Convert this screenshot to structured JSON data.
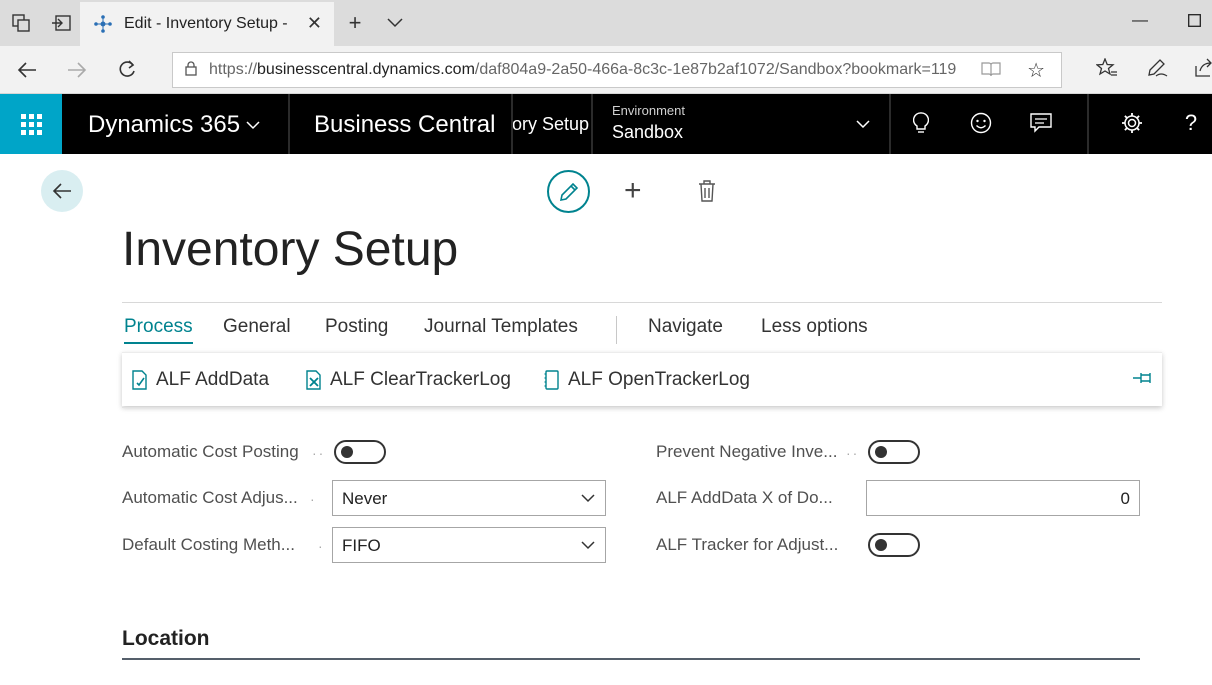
{
  "browser": {
    "tab_title": "Edit - Inventory Setup -",
    "url_prefix": "https://",
    "url_host": "businesscentral.dynamics.com",
    "url_path": "/daf804a9-2a50-466a-8c3c-1e87b2af1072/Sandbox?bookmark=119"
  },
  "appbar": {
    "product": "Dynamics 365",
    "app": "Business Central",
    "breadcrumb": "Inventory Setup",
    "env_label": "Environment",
    "env_value": "Sandbox"
  },
  "page": {
    "title": "Inventory Setup"
  },
  "action_tabs": [
    "Process",
    "General",
    "Posting",
    "Journal Templates",
    "Navigate",
    "Less options"
  ],
  "actions": [
    "ALF AddData",
    "ALF ClearTrackerLog",
    "ALF OpenTrackerLog"
  ],
  "fields": {
    "automatic_cost_posting": {
      "label": "Automatic Cost Posting",
      "value": false
    },
    "automatic_cost_adjustment": {
      "label": "Automatic Cost Adjus...",
      "value": "Never"
    },
    "default_costing_method": {
      "label": "Default Costing Meth...",
      "value": "FIFO"
    },
    "prevent_negative_inventory": {
      "label": "Prevent Negative Inve...",
      "value": false
    },
    "alf_adddata_x": {
      "label": "ALF AddData X of Do...",
      "value": "0"
    },
    "alf_tracker": {
      "label": "ALF Tracker for Adjust...",
      "value": false
    }
  },
  "section": {
    "location": "Location"
  },
  "colors": {
    "accent": "#00838f",
    "waffle": "#00a5c8",
    "appbar": "#000000"
  }
}
